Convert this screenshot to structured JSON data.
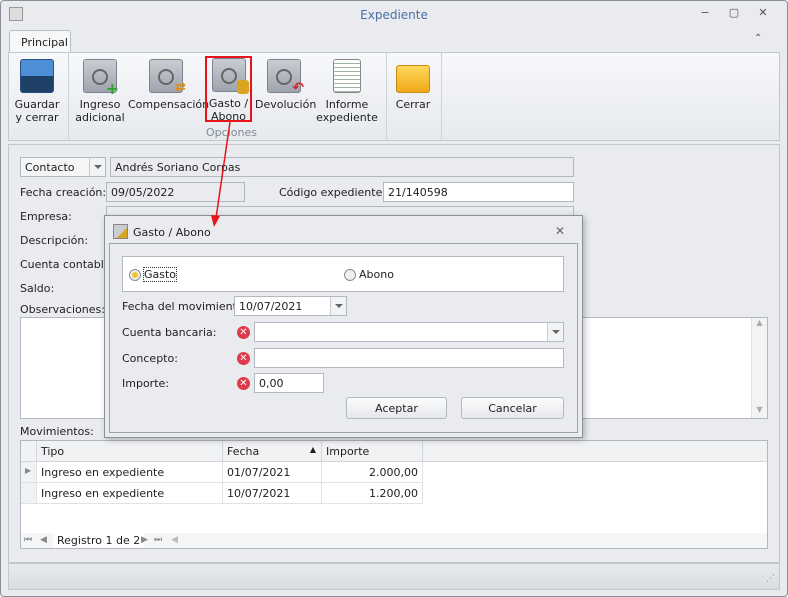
{
  "window": {
    "title": "Expediente",
    "minimize": "−",
    "maximize": "▢",
    "close": "✕"
  },
  "ribbon": {
    "tab": "Principal",
    "group_label": "Opciones",
    "buttons": [
      {
        "label1": "Guardar",
        "label2": "y cerrar",
        "icon": "floppy-disk-icon"
      },
      {
        "label1": "Ingreso",
        "label2": "adicional",
        "icon": "safe-add-icon"
      },
      {
        "label1": "Compensación",
        "label2": "",
        "icon": "safe-exchange-icon"
      },
      {
        "label1": "Gasto /",
        "label2": "Abono",
        "icon": "safe-coins-icon",
        "highlighted": true
      },
      {
        "label1": "Devolución",
        "label2": "",
        "icon": "safe-return-icon"
      },
      {
        "label1": "Informe",
        "label2": "expediente",
        "icon": "report-icon"
      },
      {
        "label1": "Cerrar",
        "label2": "",
        "icon": "folder-close-icon"
      }
    ],
    "highlight_color": "#e8141b"
  },
  "form": {
    "contact_type": "Contacto",
    "contact_name": "Andrés Soriano Corpas",
    "fecha_creacion_label": "Fecha creación:",
    "fecha_creacion": "09/05/2022",
    "codigo_label": "Código expediente:",
    "codigo": "21/140598",
    "empresa_label": "Empresa:",
    "descripcion_label": "Descripción:",
    "cuenta_label": "Cuenta contable:",
    "saldo_label": "Saldo:",
    "observaciones_label": "Observaciones:"
  },
  "movimientos": {
    "label": "Movimientos:",
    "columns": [
      "Tipo",
      "Fecha",
      "Importe"
    ],
    "rows": [
      {
        "tipo": "Ingreso en expediente",
        "fecha": "01/07/2021",
        "importe": "2.000,00"
      },
      {
        "tipo": "Ingreso en expediente",
        "fecha": "10/07/2021",
        "importe": "1.200,00"
      }
    ],
    "nav_text": "Registro 1 de 2"
  },
  "dialog": {
    "title": "Gasto / Abono",
    "close": "✕",
    "option_gasto": "Gasto",
    "option_abono": "Abono",
    "selected": "Gasto",
    "fecha_label": "Fecha del movimiento:",
    "fecha": "10/07/2021",
    "cuenta_label": "Cuenta bancaria:",
    "cuenta": "",
    "concepto_label": "Concepto:",
    "concepto": "",
    "importe_label": "Importe:",
    "importe": "0,00",
    "error_glyph": "✕",
    "accept": "Aceptar",
    "cancel": "Cancelar"
  }
}
